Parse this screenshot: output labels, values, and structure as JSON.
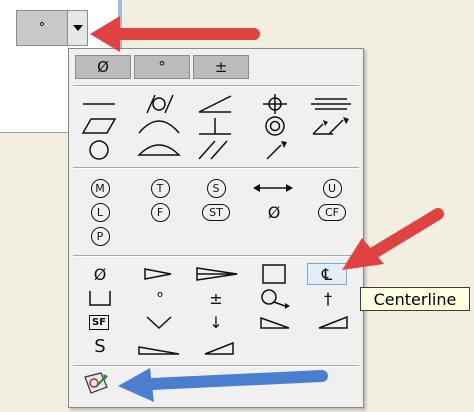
{
  "button": {
    "main_symbol": "°"
  },
  "top_buttons": [
    {
      "name": "diameter-button",
      "label": "Ø"
    },
    {
      "name": "degree-button",
      "label": "°"
    },
    {
      "name": "plus-minus-button",
      "label": "±"
    }
  ],
  "modifiers": {
    "m": "M",
    "t": "T",
    "s": "S",
    "u": "U",
    "l": "L",
    "f": "F",
    "st": "ST",
    "cf": "CF",
    "p": "P",
    "diameter": "Ø"
  },
  "symbols": {
    "diameter": "Ø",
    "degree": "°",
    "plus_minus": "±",
    "down_arrow": "↓",
    "dagger": "†",
    "centerline": "℄",
    "sf": "SF",
    "section": "S"
  },
  "tooltip": {
    "text": "Centerline"
  },
  "colors": {
    "red_arrow": "#e0433f",
    "blue_arrow": "#4a7fd0",
    "tooltip_bg": "#ffffe1"
  }
}
